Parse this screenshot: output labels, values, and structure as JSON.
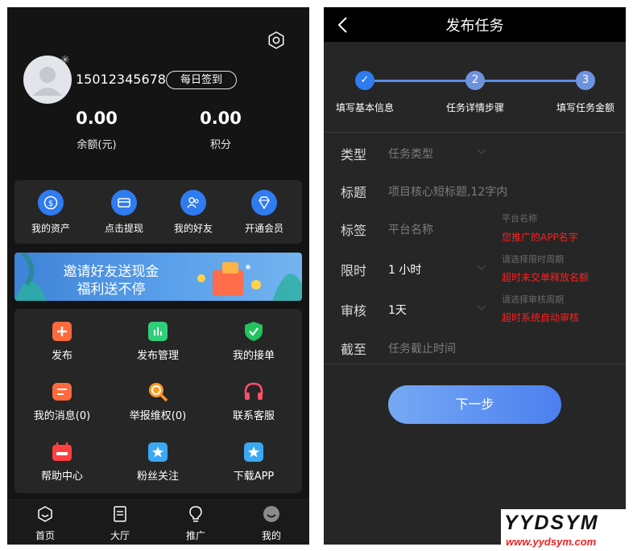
{
  "left": {
    "user": {
      "phone": "15012345678",
      "signin_label": "每日签到"
    },
    "stats": [
      {
        "value": "0.00",
        "label": "余额(元)"
      },
      {
        "value": "0.00",
        "label": "积分"
      }
    ],
    "quick_actions": [
      {
        "label": "我的资产",
        "icon": "coin-icon",
        "color": "#2f7bf0"
      },
      {
        "label": "点击提现",
        "icon": "wallet-card-icon",
        "color": "#2f7bf0"
      },
      {
        "label": "我的好友",
        "icon": "friends-icon",
        "color": "#2f7bf0"
      },
      {
        "label": "开通会员",
        "icon": "diamond-icon",
        "color": "#2f7bf0"
      }
    ],
    "banner": {
      "line1": "邀请好友送现金",
      "line2": "福利送不停"
    },
    "grid": [
      {
        "label": "发布",
        "icon": "plus-icon",
        "color": "#ff6a3d"
      },
      {
        "label": "发布管理",
        "icon": "bar-chart-icon",
        "color": "#2fcf7a"
      },
      {
        "label": "我的接单",
        "icon": "shield-check-icon",
        "color": "#22c35e"
      },
      {
        "label": "我的消息(0)",
        "icon": "message-icon",
        "color": "#ff6a3d"
      },
      {
        "label": "举报维权(0)",
        "icon": "search-report-icon",
        "color": "#ff9a1f"
      },
      {
        "label": "联系客服",
        "icon": "headset-icon",
        "color": "#ff4d6a"
      },
      {
        "label": "帮助中心",
        "icon": "help-calendar-icon",
        "color": "#ff4040"
      },
      {
        "label": "粉丝关注",
        "icon": "star-badge-icon",
        "color": "#3aa8f5"
      },
      {
        "label": "下载APP",
        "icon": "download-star-icon",
        "color": "#3aa8f5"
      }
    ],
    "nav": [
      {
        "label": "首页",
        "icon": "home-icon"
      },
      {
        "label": "大厅",
        "icon": "hall-icon"
      },
      {
        "label": "推广",
        "icon": "bulb-icon"
      },
      {
        "label": "我的",
        "icon": "profile-icon"
      }
    ]
  },
  "right": {
    "title": "发布任务",
    "steps": [
      {
        "num": "✓",
        "label": "填写基本信息"
      },
      {
        "num": "2",
        "label": "任务详情步骤"
      },
      {
        "num": "3",
        "label": "填写任务金额"
      }
    ],
    "fields": {
      "type": {
        "label": "类型",
        "placeholder": "任务类型"
      },
      "title": {
        "label": "标题",
        "placeholder": "项目核心短标题,12字内"
      },
      "tag": {
        "label": "标签",
        "placeholder": "平台名称",
        "hint_gray": "平台名称",
        "hint_red": "您推广的APP名字"
      },
      "limit": {
        "label": "限时",
        "value": "1 小时",
        "hint_gray": "请选择限时周期",
        "hint_red": "超时未交单释放名额"
      },
      "review": {
        "label": "审核",
        "value": "1天",
        "hint_gray": "请选择审核周期",
        "hint_red": "超时系统自动审核"
      },
      "deadline": {
        "label": "截至",
        "placeholder": "任务截止时间"
      }
    },
    "next_label": "下一步"
  },
  "watermark": {
    "big": "YYDSYM",
    "small": "www.yydsym.com"
  }
}
